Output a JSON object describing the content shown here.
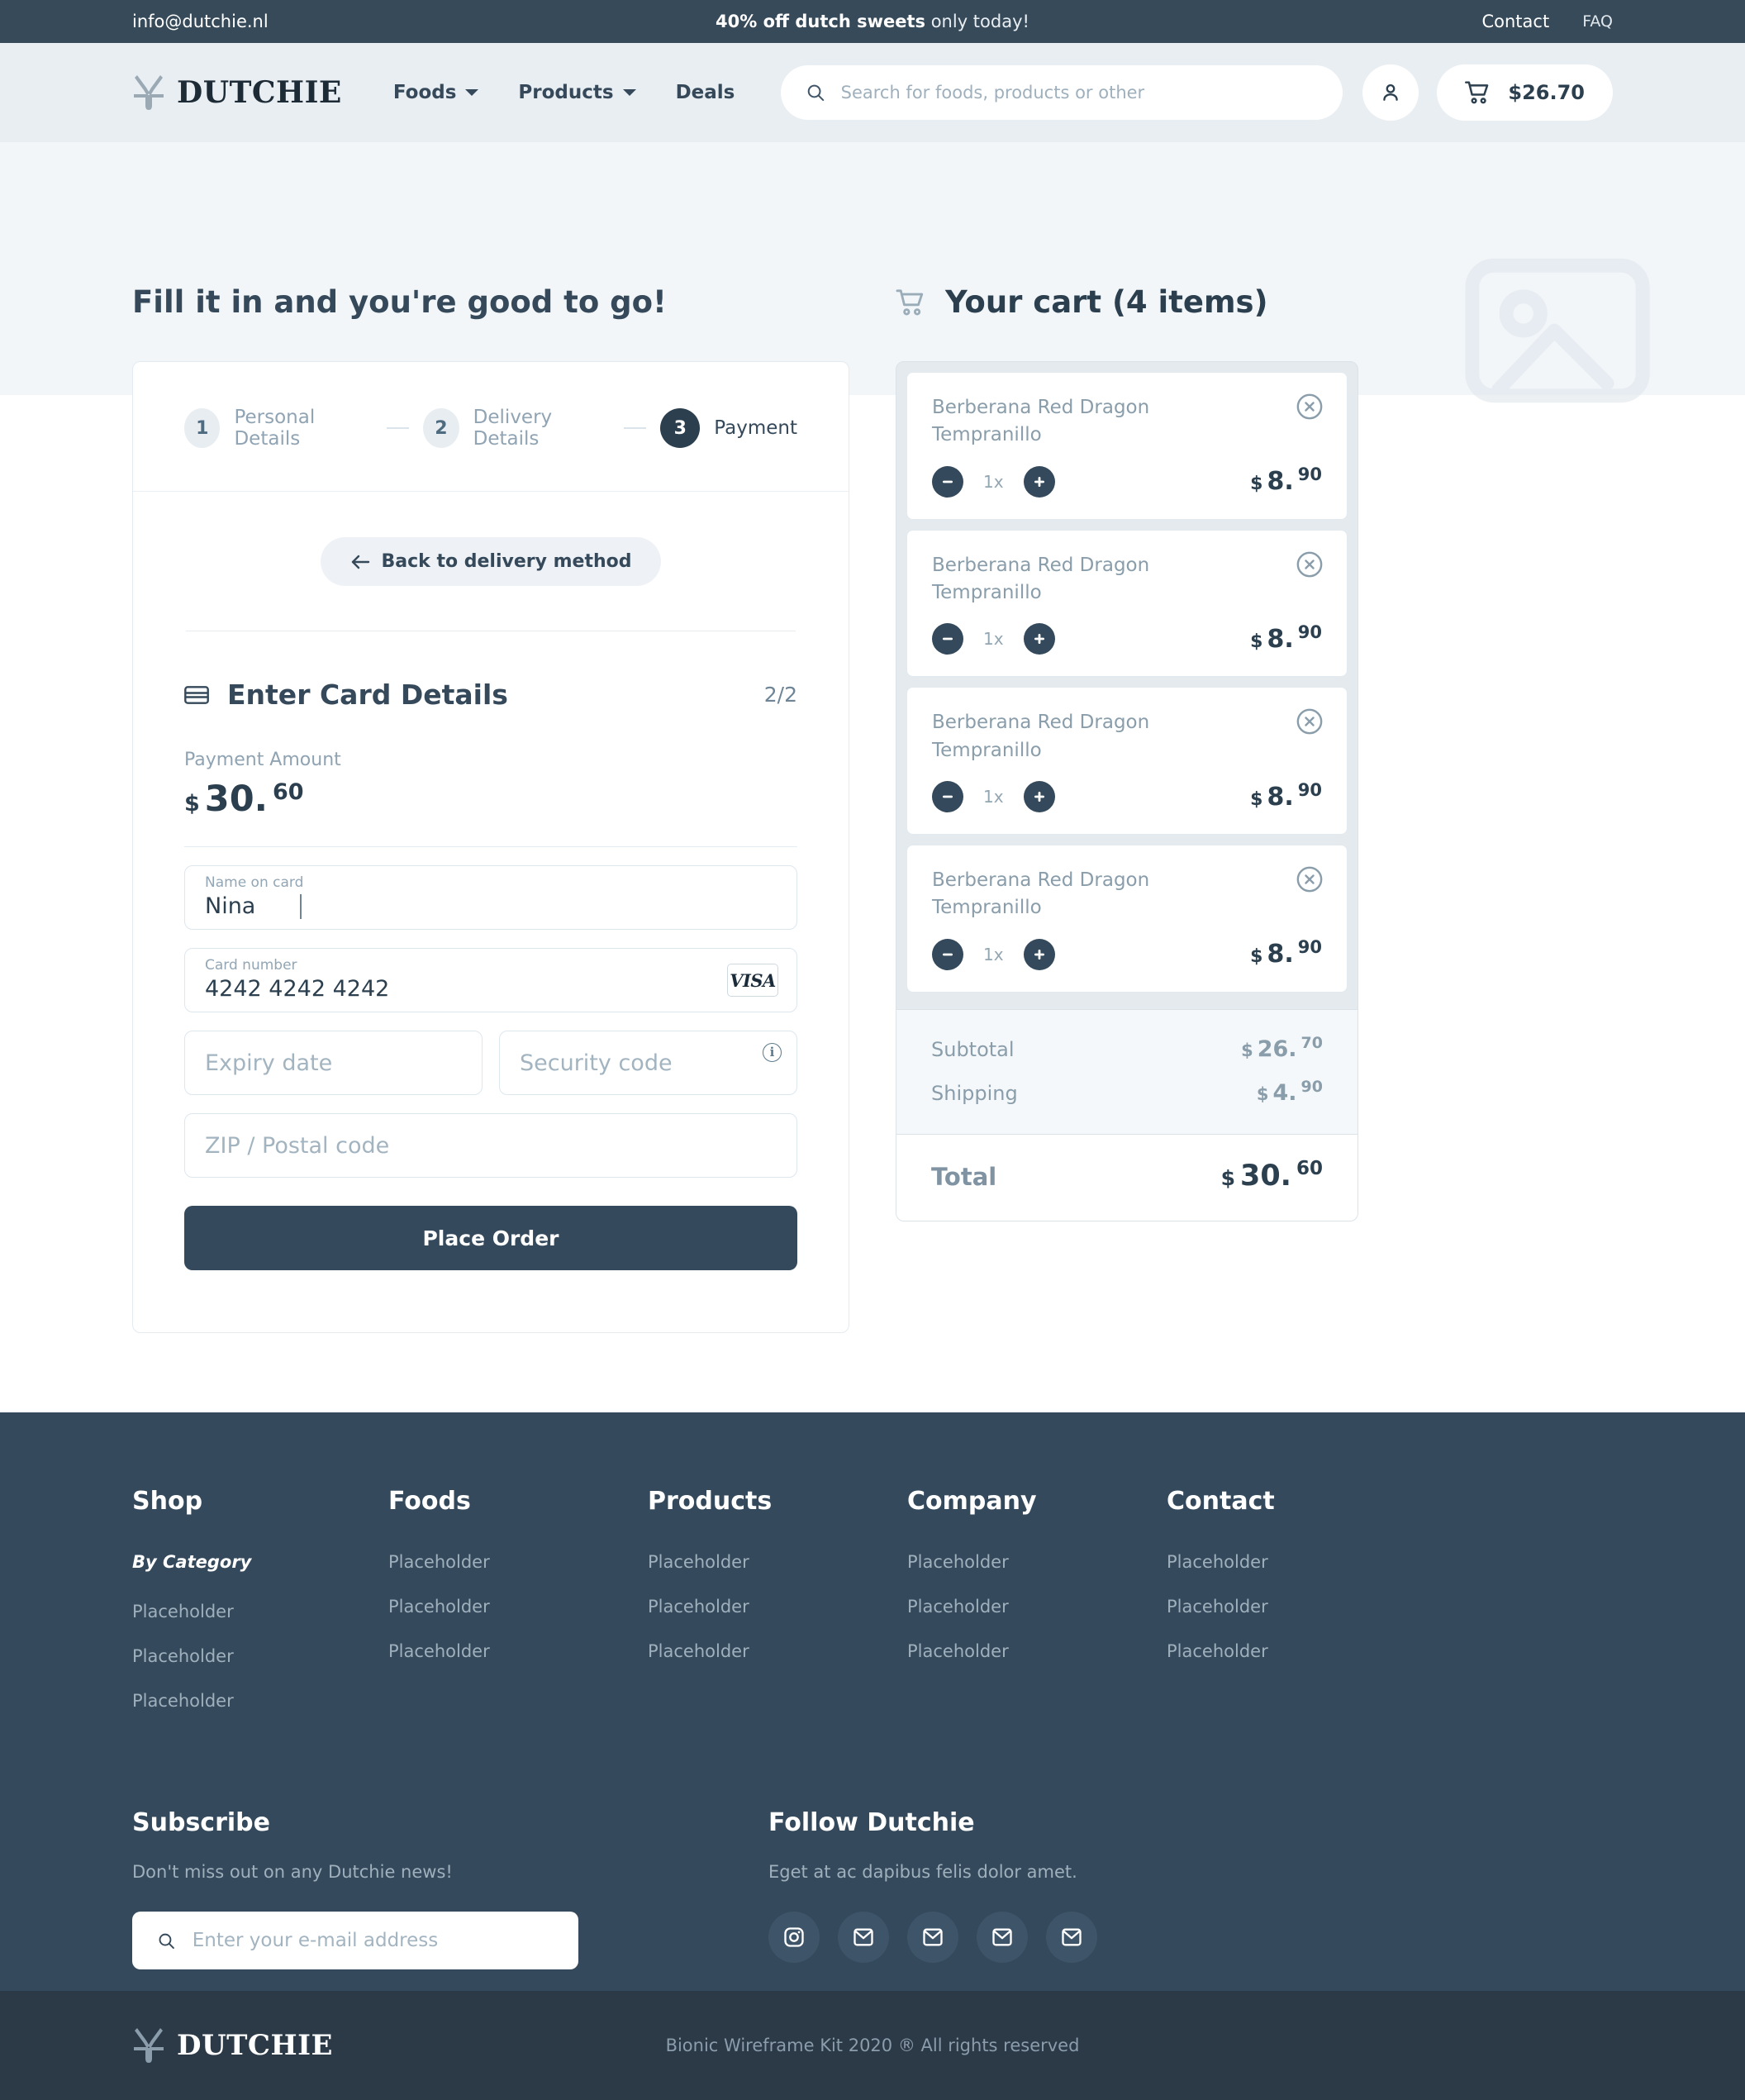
{
  "topbar": {
    "email": "info@dutchie.nl",
    "promo_bold": "40% off dutch sweets",
    "promo_rest": " only today!",
    "contact": "Contact",
    "faq": "FAQ"
  },
  "header": {
    "brand": "DUTCHIE",
    "nav": [
      {
        "label": "Foods",
        "has_caret": true
      },
      {
        "label": "Products",
        "has_caret": true
      },
      {
        "label": "Deals",
        "has_caret": false
      }
    ],
    "search_placeholder": "Search for foods, products or other",
    "search_value": "",
    "cart_amount": "$26.70"
  },
  "main": {
    "title": "Fill it in and you're good to go!",
    "steps": [
      {
        "num": "1",
        "label": "Personal Details"
      },
      {
        "num": "2",
        "label": "Delivery Details"
      },
      {
        "num": "3",
        "label": "Payment"
      }
    ],
    "back_button": "Back to delivery method",
    "card_section_title": "Enter Card Details",
    "card_section_count": "2/2",
    "payment_amount_label": "Payment Amount",
    "payment_amount": {
      "currency": "$",
      "whole": "30.",
      "cents": "60"
    },
    "fields": {
      "name_label": "Name on card",
      "name_value": "Nina",
      "card_label": "Card number",
      "card_value": "4242 4242 4242",
      "card_brand": "VISA",
      "expiry_placeholder": "Expiry date",
      "security_placeholder": "Security code",
      "zip_placeholder": "ZIP / Postal code"
    },
    "place_order": "Place Order"
  },
  "cart": {
    "title": "Your cart (4 items)",
    "items": [
      {
        "name": "Berberana Red Dragon Tempranillo",
        "qty": "1x",
        "currency": "$",
        "whole": "8.",
        "cents": "90"
      },
      {
        "name": "Berberana Red Dragon Tempranillo",
        "qty": "1x",
        "currency": "$",
        "whole": "8.",
        "cents": "90"
      },
      {
        "name": "Berberana Red Dragon Tempranillo",
        "qty": "1x",
        "currency": "$",
        "whole": "8.",
        "cents": "90"
      },
      {
        "name": "Berberana Red Dragon Tempranillo",
        "qty": "1x",
        "currency": "$",
        "whole": "8.",
        "cents": "90"
      }
    ],
    "subtotal_label": "Subtotal",
    "subtotal": {
      "currency": "$",
      "whole": "26.",
      "cents": "70"
    },
    "shipping_label": "Shipping",
    "shipping": {
      "currency": "$",
      "whole": "4.",
      "cents": "90"
    },
    "total_label": "Total",
    "total": {
      "currency": "$",
      "whole": "30.",
      "cents": "60"
    }
  },
  "footer": {
    "columns": [
      {
        "heading": "Shop",
        "sub": "By Category",
        "links": [
          "Placeholder",
          "Placeholder",
          "Placeholder"
        ]
      },
      {
        "heading": "Foods",
        "sub": "",
        "links": [
          "Placeholder",
          "Placeholder",
          "Placeholder"
        ]
      },
      {
        "heading": "Products",
        "sub": "",
        "links": [
          "Placeholder",
          "Placeholder",
          "Placeholder"
        ]
      },
      {
        "heading": "Company",
        "sub": "",
        "links": [
          "Placeholder",
          "Placeholder",
          "Placeholder"
        ]
      },
      {
        "heading": "Contact",
        "sub": "",
        "links": [
          "Placeholder",
          "Placeholder",
          "Placeholder"
        ]
      }
    ],
    "subscribe_heading": "Subscribe",
    "subscribe_text": "Don't miss out on any Dutchie news!",
    "subscribe_placeholder": "Enter your e-mail address",
    "follow_heading": "Follow Dutchie",
    "follow_text": "Eget at ac dapibus felis dolor amet.",
    "socials": [
      "instagram-icon",
      "mail-icon",
      "mail-icon",
      "mail-icon",
      "mail-icon"
    ],
    "brand": "DUTCHIE",
    "copyright": "Bionic Wireframe Kit 2020 ® All rights reserved"
  },
  "colors": {
    "dark": "#34495c",
    "darker": "#2c3a48",
    "header_bg": "#e9eef2",
    "hero_bg": "#f2f6f9",
    "muted": "#8a9daa"
  }
}
